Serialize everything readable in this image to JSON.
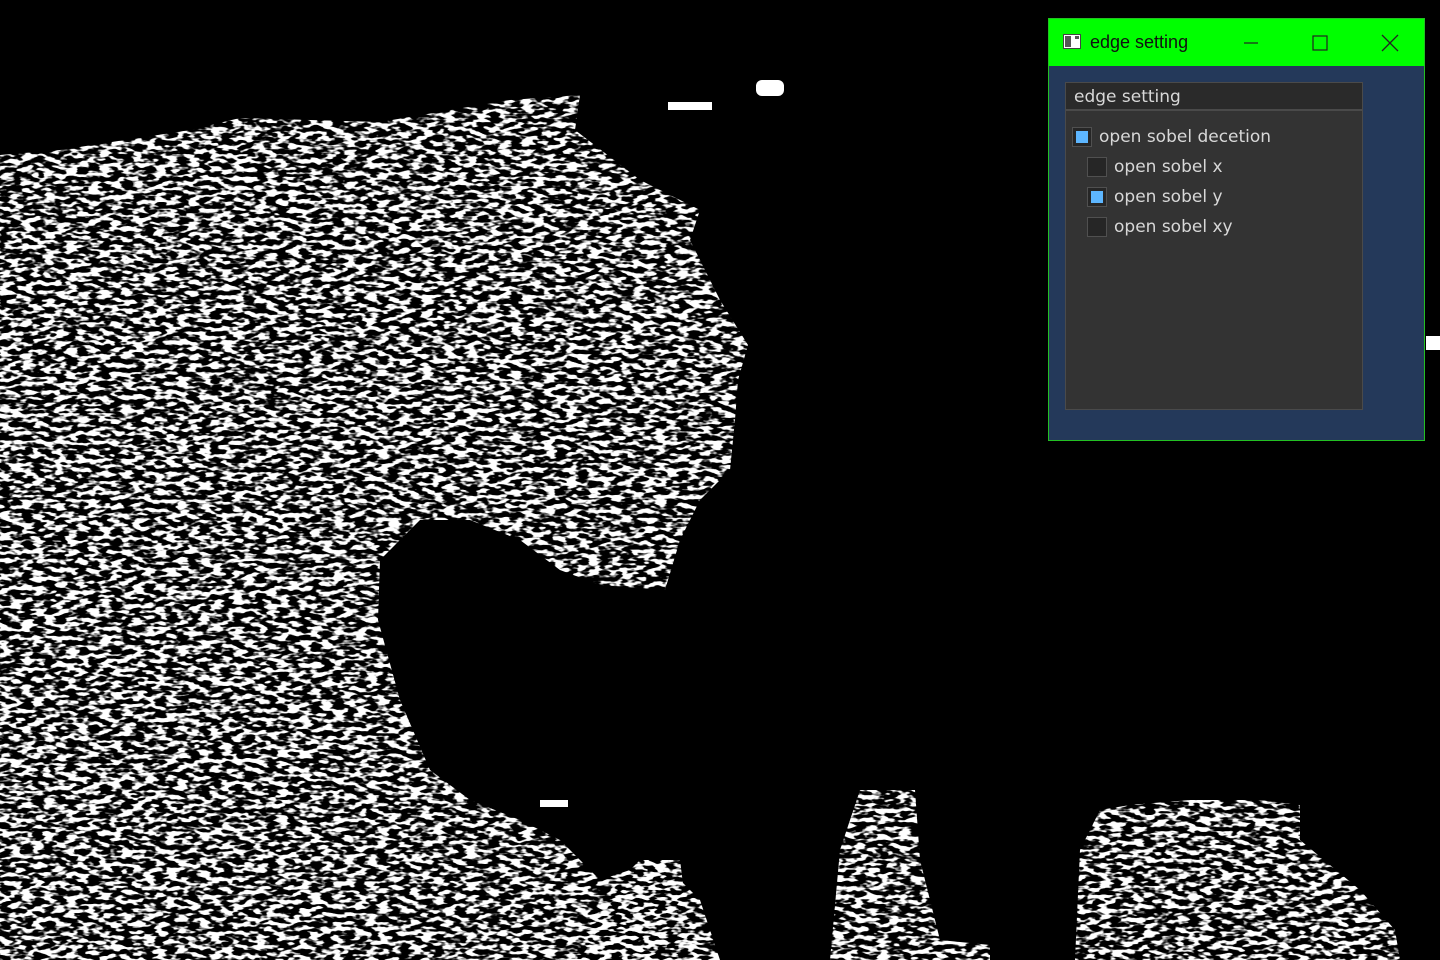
{
  "window": {
    "title": "edge setting",
    "titlebar_color": "#00ff00",
    "background_color": "#24395a",
    "buttons": {
      "minimize_icon": "minimize-icon",
      "maximize_icon": "maximize-icon",
      "close_icon": "close-icon"
    }
  },
  "panel": {
    "title": "edge setting",
    "checkboxes": [
      {
        "label": "open sobel decetion",
        "checked": true
      },
      {
        "label": "open sobel x",
        "checked": false
      },
      {
        "label": "open sobel y",
        "checked": true
      },
      {
        "label": "open sobel xy",
        "checked": false
      }
    ],
    "check_color": "#5db6ff"
  },
  "image": {
    "description_icon": "tiger-edge-image",
    "background_color": "#000000",
    "edge_color": "#ffffff"
  }
}
